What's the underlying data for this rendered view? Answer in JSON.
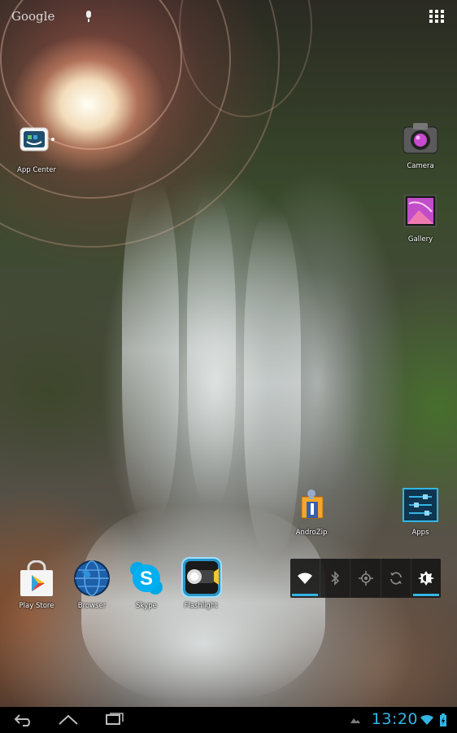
{
  "search_bar": {
    "logo": "Google"
  },
  "home": {
    "top_apps": [
      {
        "label": "App Center",
        "icon": "app-center-icon"
      },
      {
        "label": "Camera",
        "icon": "camera-icon"
      },
      {
        "label": "Gallery",
        "icon": "gallery-icon"
      }
    ],
    "mid_apps": [
      {
        "label": "AndroZip",
        "icon": "androzip-icon"
      },
      {
        "label": "Apps",
        "icon": "apps-settings-icon"
      }
    ],
    "dock_apps": [
      {
        "label": "Play Store",
        "icon": "play-store-icon"
      },
      {
        "label": "Browser",
        "icon": "browser-globe-icon"
      },
      {
        "label": "Skype",
        "icon": "skype-icon"
      },
      {
        "label": "Flashlight",
        "icon": "flashlight-icon"
      }
    ]
  },
  "quick_settings": [
    {
      "name": "wifi",
      "active": true
    },
    {
      "name": "bluetooth",
      "active": false
    },
    {
      "name": "gps",
      "active": false
    },
    {
      "name": "sync",
      "active": false
    },
    {
      "name": "brightness",
      "active": true
    }
  ],
  "status": {
    "time": "13:20"
  },
  "colors": {
    "accent": "#33b5e5"
  }
}
